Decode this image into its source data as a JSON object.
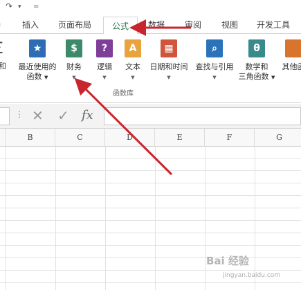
{
  "quick_access": {
    "redo_icon": "↷",
    "dropdown_icon": "▾",
    "customize_icon": "="
  },
  "tabs": [
    {
      "label": "插入"
    },
    {
      "label": "页面布局"
    },
    {
      "label": "公式",
      "active": true
    },
    {
      "label": "数据"
    },
    {
      "label": "审阅"
    },
    {
      "label": "视图"
    },
    {
      "label": "开发工具"
    }
  ],
  "ribbon": {
    "partial_left_label": "求和",
    "buttons": [
      {
        "line1": "最近使用的",
        "line2": "函数",
        "icon": "star-icon",
        "glyph": "★",
        "color": "#2e6db4"
      },
      {
        "line1": "财务",
        "line2": "",
        "icon": "finance-icon",
        "glyph": "$",
        "color": "#3c8a6a"
      },
      {
        "line1": "逻辑",
        "line2": "",
        "icon": "logical-icon",
        "glyph": "?",
        "color": "#7d3f98"
      },
      {
        "line1": "文本",
        "line2": "",
        "icon": "text-icon",
        "glyph": "A",
        "color": "#e8a33d"
      },
      {
        "line1": "日期和时间",
        "line2": "",
        "icon": "date-time-icon",
        "glyph": "▦",
        "color": "#d0563b"
      },
      {
        "line1": "查找与引用",
        "line2": "",
        "icon": "lookup-icon",
        "glyph": "⌕",
        "color": "#2a73b8"
      },
      {
        "line1": "数学和",
        "line2": "三角函数",
        "icon": "math-trig-icon",
        "glyph": "θ",
        "color": "#3a8a8c"
      },
      {
        "line1": "其他函",
        "line2": "",
        "icon": "more-functions-icon",
        "glyph": "",
        "color": "#d9742e"
      }
    ],
    "group_label": "函数库"
  },
  "formula_bar": {
    "dots": "⋮",
    "cancel": "✕",
    "enter": "✓",
    "fx": "fx"
  },
  "columns": [
    "B",
    "C",
    "D",
    "E",
    "F",
    "G"
  ],
  "watermark": {
    "text": "Bai 经验",
    "url": "jingyan.baidu.com"
  },
  "colors": {
    "accent": "#217346",
    "annotation_arrow": "#c8262e"
  }
}
